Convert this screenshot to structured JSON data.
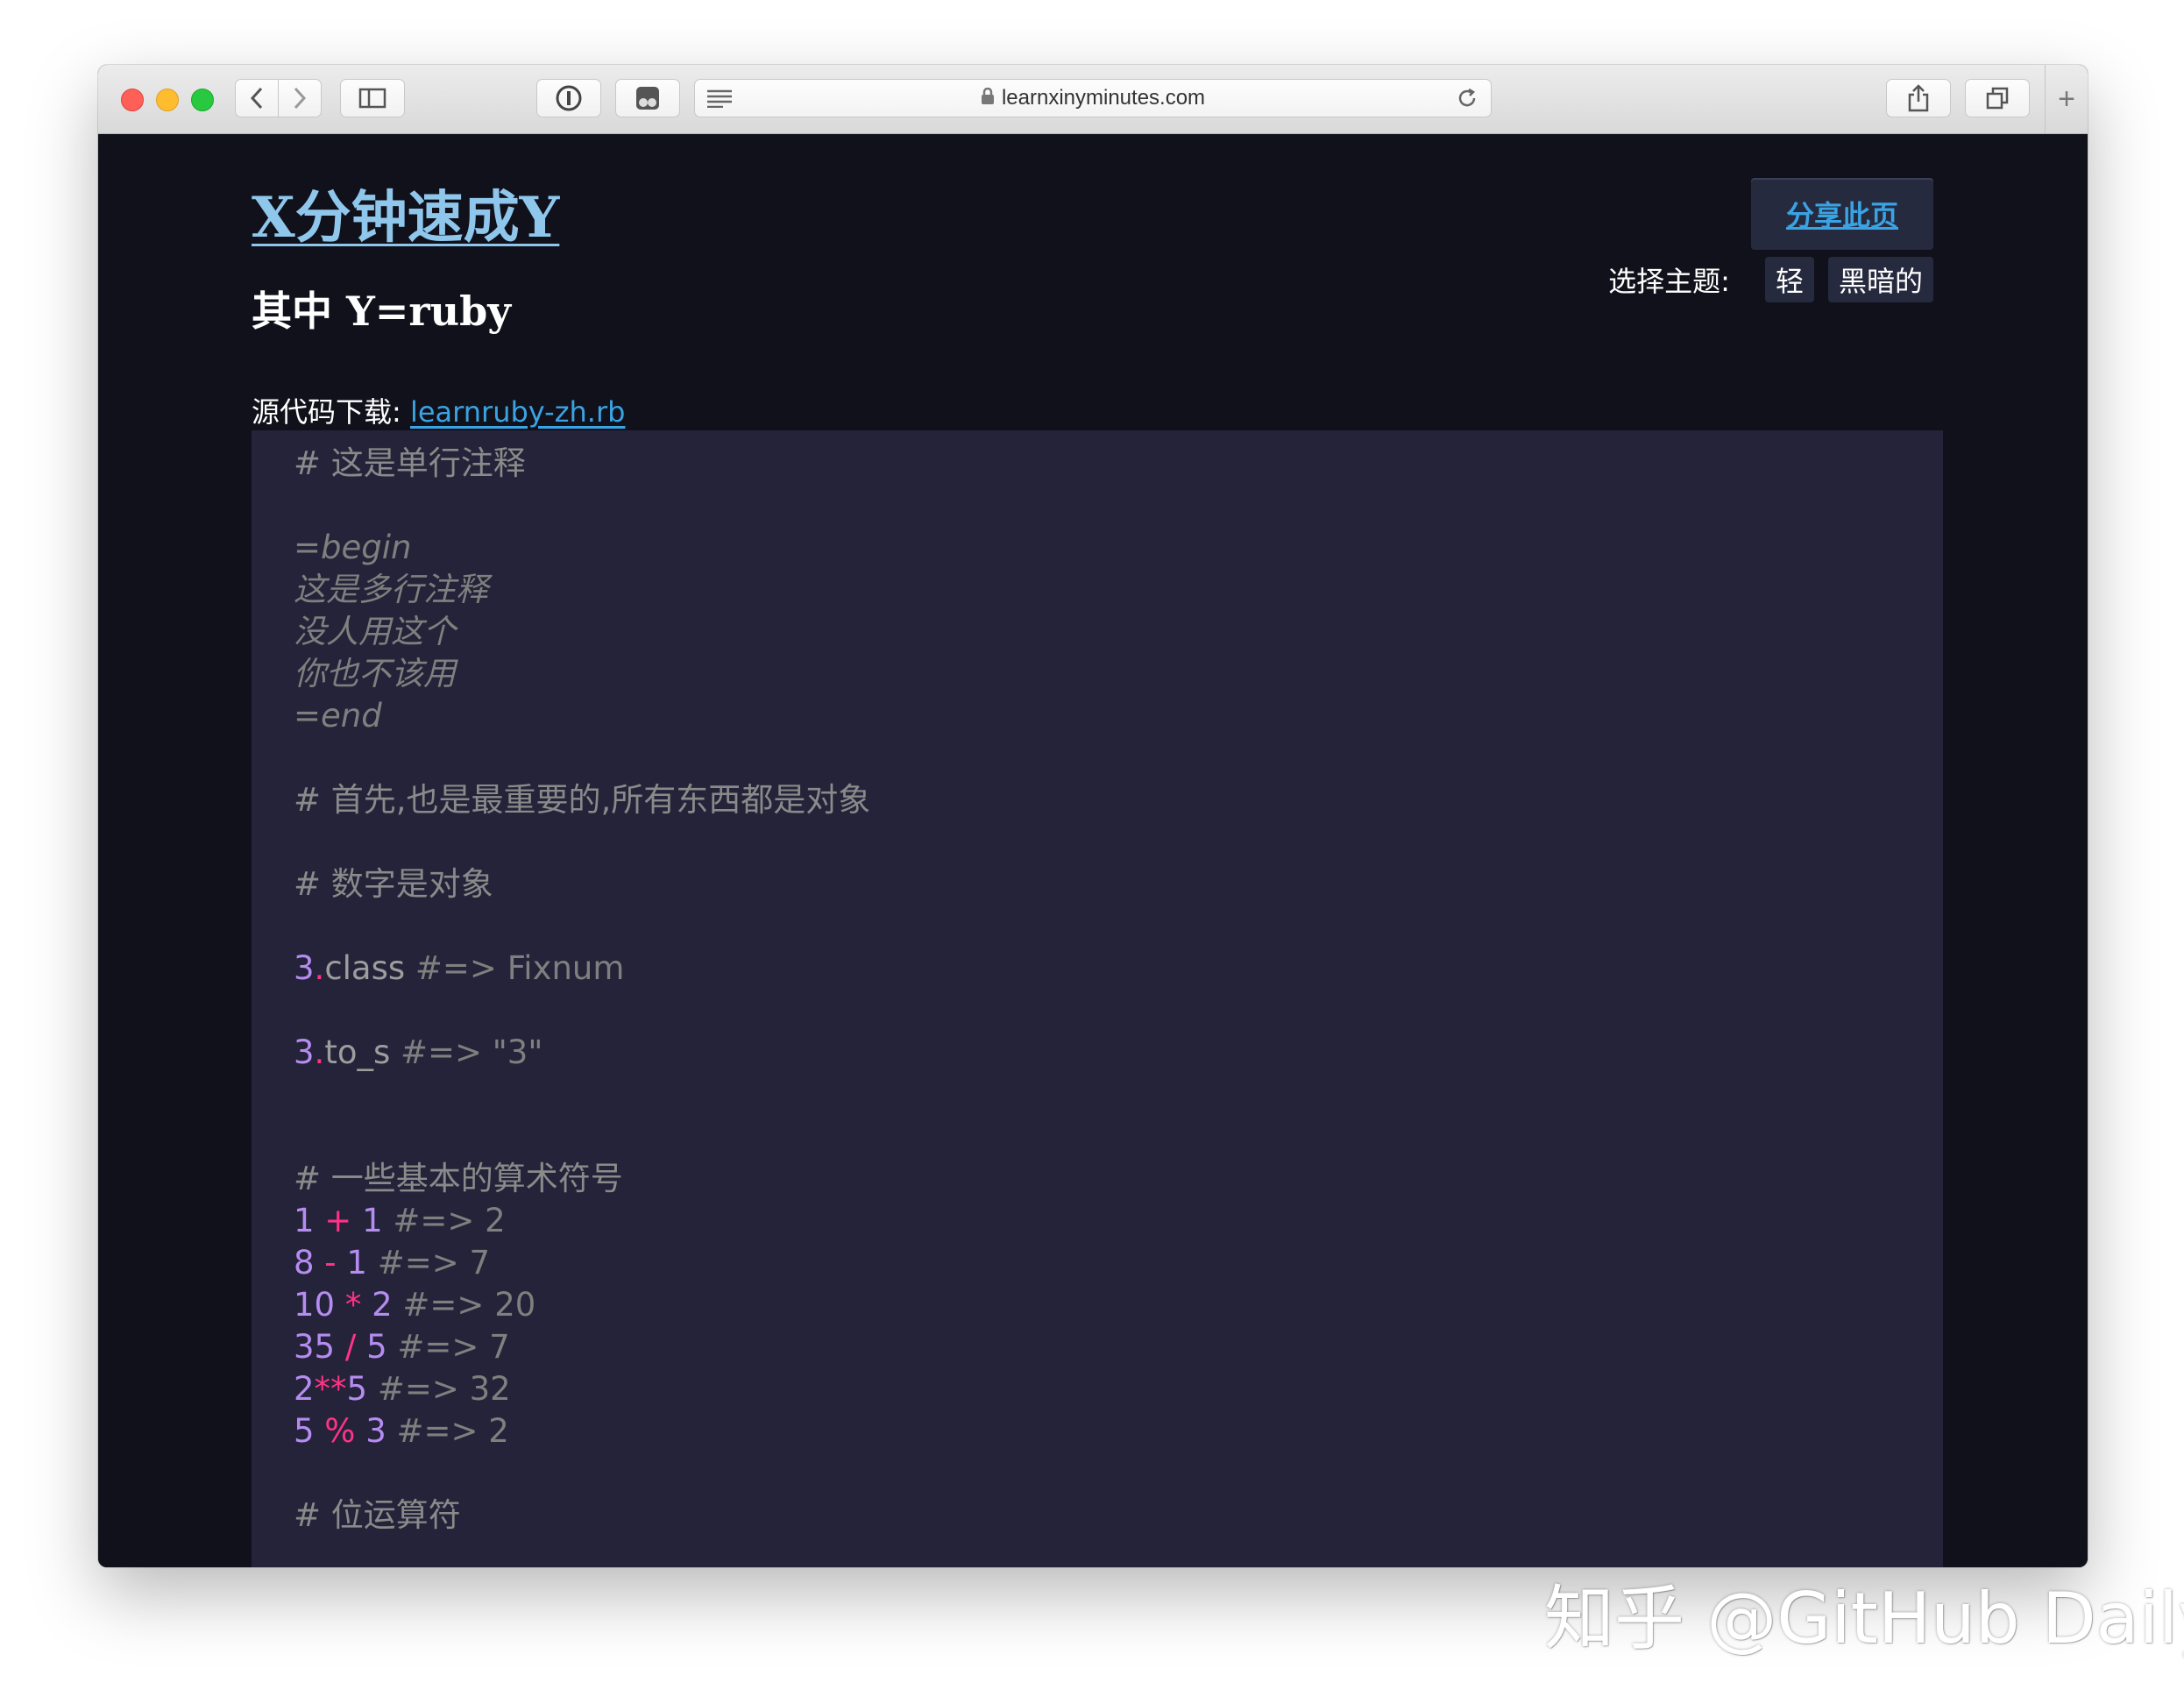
{
  "browser": {
    "url": "learnxinyminutes.com",
    "new_tab_label": "+"
  },
  "page": {
    "site_title": "X分钟速成Y",
    "subtitle": "其中 Y=ruby",
    "share_label": "分享此页",
    "theme_label": "选择主题:",
    "theme_light": "轻",
    "theme_dark": "黑暗的",
    "source_label": "源代码下载: ",
    "source_file": "learnruby-zh.rb"
  },
  "code": {
    "l1": "# 这是单行注释",
    "l2": "=begin",
    "l3": "这是多行注释",
    "l4": "没人用这个",
    "l5": "你也不该用",
    "l6": "=end",
    "l7": "# 首先,也是最重要的,所有东西都是对象",
    "l8": "# 数字是对象",
    "l9": {
      "num": "3",
      "dot": ".",
      "ident": "class",
      "result": " #=> Fixnum"
    },
    "l10": {
      "num": "3",
      "dot": ".",
      "ident": "to_s",
      "result": " #=> \"3\""
    },
    "l11": "# 一些基本的算术符号",
    "arith": [
      {
        "a": "1",
        "op": " + ",
        "b": "1",
        "result": " #=> 2"
      },
      {
        "a": "8",
        "op": " - ",
        "b": "1",
        "result": " #=> 7"
      },
      {
        "a": "10",
        "op": " * ",
        "b": "2",
        "result": " #=> 20"
      },
      {
        "a": "35",
        "op": " / ",
        "b": "5",
        "result": " #=> 7"
      },
      {
        "a": "2",
        "op": "**",
        "b": "5",
        "result": " #=> 32"
      },
      {
        "a": "5",
        "op": " % ",
        "b": "3",
        "result": " #=> 2"
      }
    ],
    "l12": "# 位运算符"
  },
  "watermark": "知乎 @GitHub Daily",
  "colors": {
    "page_bg": "#11111b",
    "code_bg": "#242339",
    "link": "#3aa3e3",
    "title": "#8fc7ec",
    "number": "#b58cf0",
    "operator": "#ff3385"
  }
}
